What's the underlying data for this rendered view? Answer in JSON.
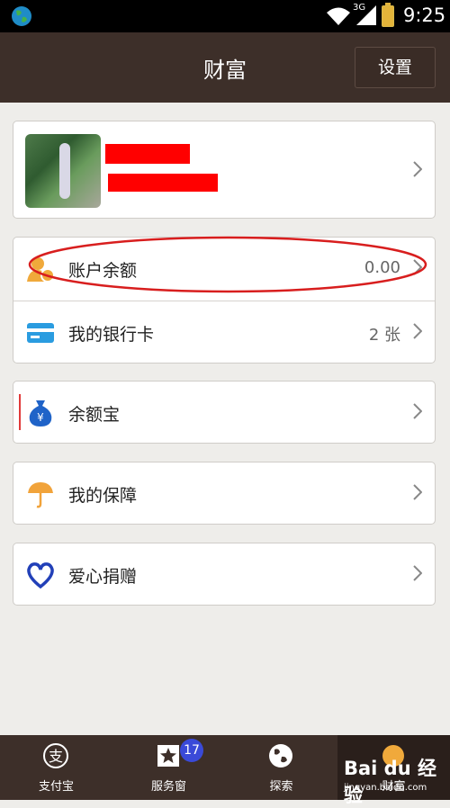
{
  "status_bar": {
    "time": "9:25",
    "network": "3G"
  },
  "header": {
    "title": "财富",
    "settings_label": "设置"
  },
  "rows": {
    "account_balance": {
      "label": "账户余额",
      "value": "0.00"
    },
    "bank_cards": {
      "label": "我的银行卡",
      "value": "2 张"
    },
    "yuebao": {
      "label": "余额宝"
    },
    "protection": {
      "label": "我的保障"
    },
    "donation": {
      "label": "爱心捐赠"
    }
  },
  "tabbar": {
    "tabs": [
      {
        "label": "支付宝"
      },
      {
        "label": "服务窗",
        "badge": "17"
      },
      {
        "label": "探索"
      },
      {
        "label": "财富"
      }
    ]
  },
  "watermark": {
    "brand": "Bai du 经验",
    "url": "jingyan.baidu.com"
  },
  "colors": {
    "header": "#3d2f29",
    "background": "#eeedea",
    "balance_icon": "#f0a93b",
    "card_icon": "#2a9ce0",
    "yuebao_icon": "#1f63c8",
    "protection_icon": "#f1a33a",
    "donation_icon": "#2240b8",
    "annotation": "#d81e1e",
    "badge": "#3a4ad8"
  }
}
